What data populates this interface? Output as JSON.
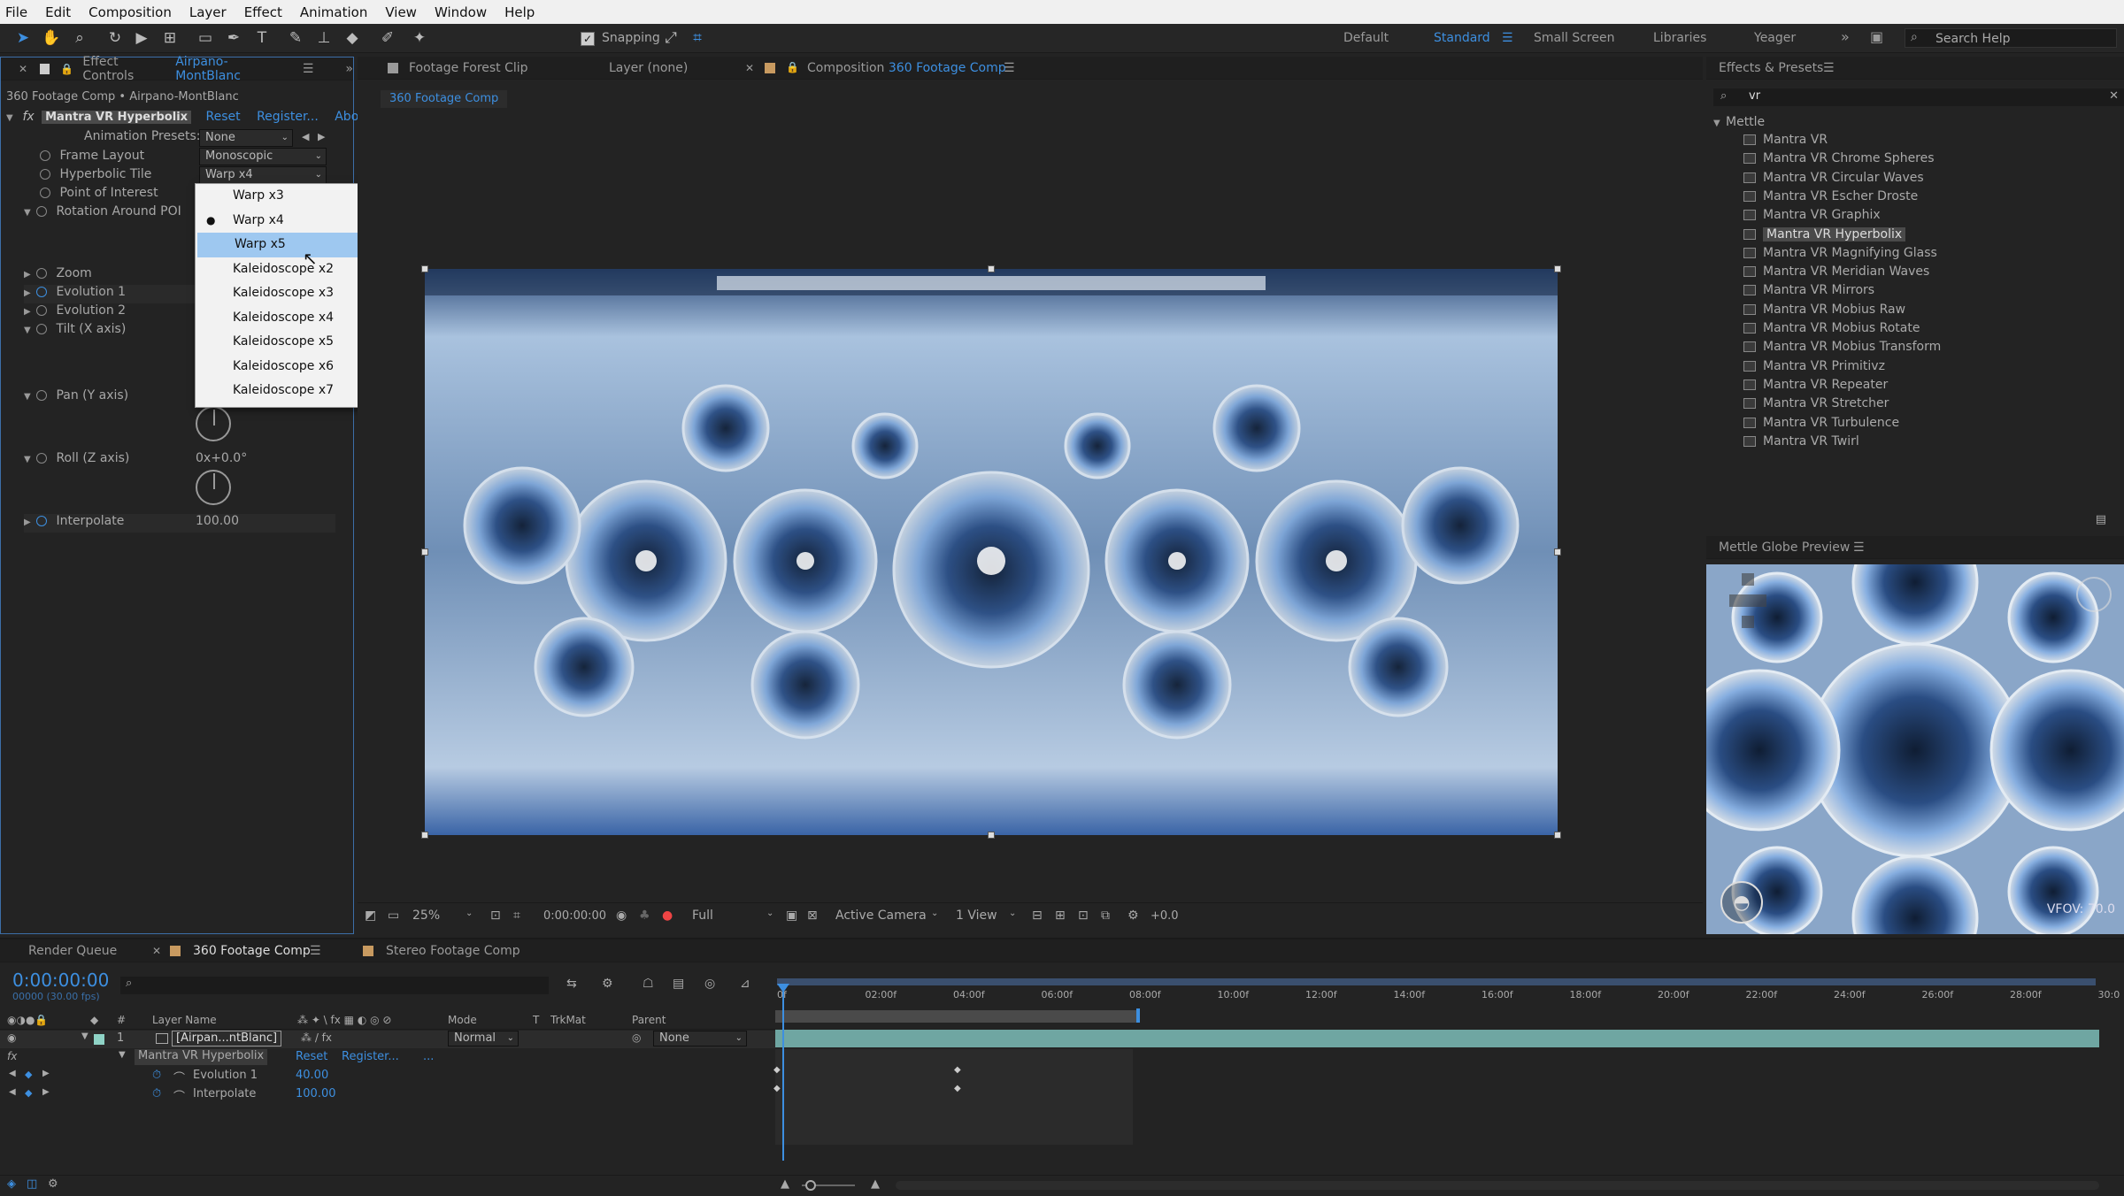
{
  "menubar": [
    "File",
    "Edit",
    "Composition",
    "Layer",
    "Effect",
    "Animation",
    "View",
    "Window",
    "Help"
  ],
  "toolbar": {
    "snapping_label": "Snapping",
    "workspaces": [
      "Default",
      "Standard",
      "Small Screen",
      "Libraries",
      "Yeager"
    ],
    "search_placeholder": "Search Help",
    "active_workspace": "Standard"
  },
  "effect_controls": {
    "tab_label": "Effect Controls",
    "tab_layer": "Airpano-MontBlanc",
    "breadcrumb": "360 Footage Comp • Airpano-MontBlanc",
    "effect_name": "Mantra VR Hyperbolix",
    "reset": "Reset",
    "register": "Register...",
    "about": "Abo",
    "anim_presets_label": "Animation Presets:",
    "anim_presets_value": "None",
    "frame_layout_label": "Frame Layout",
    "frame_layout_value": "Monoscopic",
    "hyperbolic_tile_label": "Hyperbolic Tile",
    "hyperbolic_tile_value": "Warp x4",
    "poi_label": "Point of Interest",
    "rotation_label": "Rotation Around POI",
    "zoom_label": "Zoom",
    "evo1_label": "Evolution 1",
    "evo2_label": "Evolution 2",
    "tilt_label": "Tilt (X axis)",
    "pan_label": "Pan (Y axis)",
    "roll_label": "Roll (Z axis)",
    "roll_value": "0x+0.0°",
    "interp_label": "Interpolate",
    "interp_value": "100.00"
  },
  "tile_menu": {
    "items": [
      "Warp x3",
      "Warp x4",
      "Warp x5",
      "Kaleidoscope x2",
      "Kaleidoscope x3",
      "Kaleidoscope x4",
      "Kaleidoscope x5",
      "Kaleidoscope x6",
      "Kaleidoscope x7"
    ],
    "checked": "Warp x4",
    "highlighted": "Warp x5"
  },
  "viewer": {
    "tab_footage": "Footage Forest Clip",
    "tab_layer": "Layer (none)",
    "tab_comp_prefix": "Composition",
    "tab_comp_name": "360 Footage Comp",
    "comp_crumb": "360 Footage Comp",
    "zoom": "25%",
    "timecode": "0:00:00:00",
    "resolution": "Full",
    "camera": "Active Camera",
    "views": "1 View",
    "exposure": "+0.0"
  },
  "effects_presets": {
    "title": "Effects & Presets",
    "search_value": "vr",
    "group": "Mettle",
    "items": [
      "Mantra VR",
      "Mantra VR Chrome Spheres",
      "Mantra VR Circular Waves",
      "Mantra VR Escher Droste",
      "Mantra VR Graphix",
      "Mantra VR Hyperbolix",
      "Mantra VR Magnifying Glass",
      "Mantra VR Meridian Waves",
      "Mantra VR Mirrors",
      "Mantra VR Mobius Raw",
      "Mantra VR Mobius Rotate",
      "Mantra VR Mobius Transform",
      "Mantra VR Primitivz",
      "Mantra VR Repeater",
      "Mantra VR Stretcher",
      "Mantra VR Turbulence",
      "Mantra VR Twirl"
    ],
    "selected": "Mantra VR Hyperbolix"
  },
  "globe_preview": {
    "title": "Mettle Globe Preview",
    "vfov": "VFOV: 70.0"
  },
  "timeline": {
    "tab_render": "Render Queue",
    "tab_comp": "360 Footage Comp",
    "tab_stereo": "Stereo Footage Comp",
    "timecode": "0:00:00:00",
    "fps": "00000 (30.00 fps)",
    "col_layer": "Layer Name",
    "col_mode": "Mode",
    "col_t": "T",
    "col_trkmat": "TrkMat",
    "col_parent": "Parent",
    "layer_num": "1",
    "layer_name": "[Airpan...ntBlanc]",
    "layer_mode": "Normal",
    "layer_parent": "None",
    "effect_name": "Mantra VR Hyperbolix",
    "effect_reset": "Reset",
    "effect_register": "Register...",
    "effect_more": "...",
    "prop1_name": "Evolution 1",
    "prop1_value": "40.00",
    "prop2_name": "Interpolate",
    "prop2_value": "100.00",
    "ruler": [
      "0f",
      "02:00f",
      "04:00f",
      "06:00f",
      "08:00f",
      "10:00f",
      "12:00f",
      "14:00f",
      "16:00f",
      "18:00f",
      "20:00f",
      "22:00f",
      "24:00f",
      "26:00f",
      "28:00f",
      "30:0"
    ]
  },
  "colors": {
    "accent": "#3d8fe0",
    "bg": "#232323",
    "menu_highlight": "#9ec8f0"
  }
}
